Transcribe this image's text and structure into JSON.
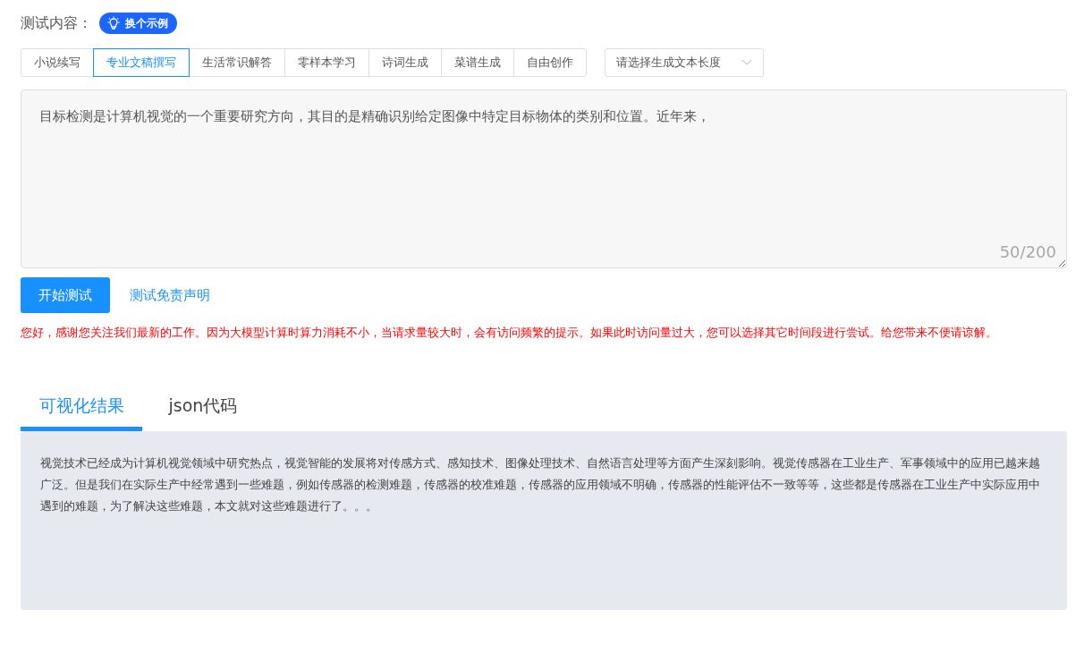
{
  "header": {
    "label": "测试内容：",
    "example_button": "换个示例"
  },
  "categories": [
    {
      "label": "小说续写",
      "selected": false
    },
    {
      "label": "专业文稿撰写",
      "selected": true
    },
    {
      "label": "生活常识解答",
      "selected": false
    },
    {
      "label": "零样本学习",
      "selected": false
    },
    {
      "label": "诗词生成",
      "selected": false
    },
    {
      "label": "菜谱生成",
      "selected": false
    },
    {
      "label": "自由创作",
      "selected": false
    }
  ],
  "length_select": {
    "placeholder": "请选择生成文本长度"
  },
  "input": {
    "value": "目标检测是计算机视觉的一个重要研究方向，其目的是精确识别给定图像中特定目标物体的类别和位置。近年来，",
    "counter": "50/200"
  },
  "actions": {
    "start_button": "开始测试",
    "disclaimer_link": "测试免责声明"
  },
  "notice": "您好，感谢您关注我们最新的工作。因为大模型计算时算力消耗不小，当请求量较大时，会有访问频繁的提示。如果此时访问量过大，您可以选择其它时间段进行尝试。给您带来不便请谅解。",
  "result_tabs": [
    {
      "label": "可视化结果",
      "selected": true
    },
    {
      "label": "json代码",
      "selected": false
    }
  ],
  "result": {
    "text": "视觉技术已经成为计算机视觉领域中研究热点，视觉智能的发展将对传感方式、感知技术、图像处理技术、自然语言处理等方面产生深刻影响。视觉传感器在工业生产、军事领域中的应用已越来越广泛。但是我们在实际生产中经常遇到一些难题，例如传感器的检测难题，传感器的校准难题，传感器的应用领域不明确，传感器的性能评估不一致等等，这些都是传感器在工业生产中实际应用中遇到的难题，为了解决这些难题，本文就对这些难题进行了。。。"
  }
}
